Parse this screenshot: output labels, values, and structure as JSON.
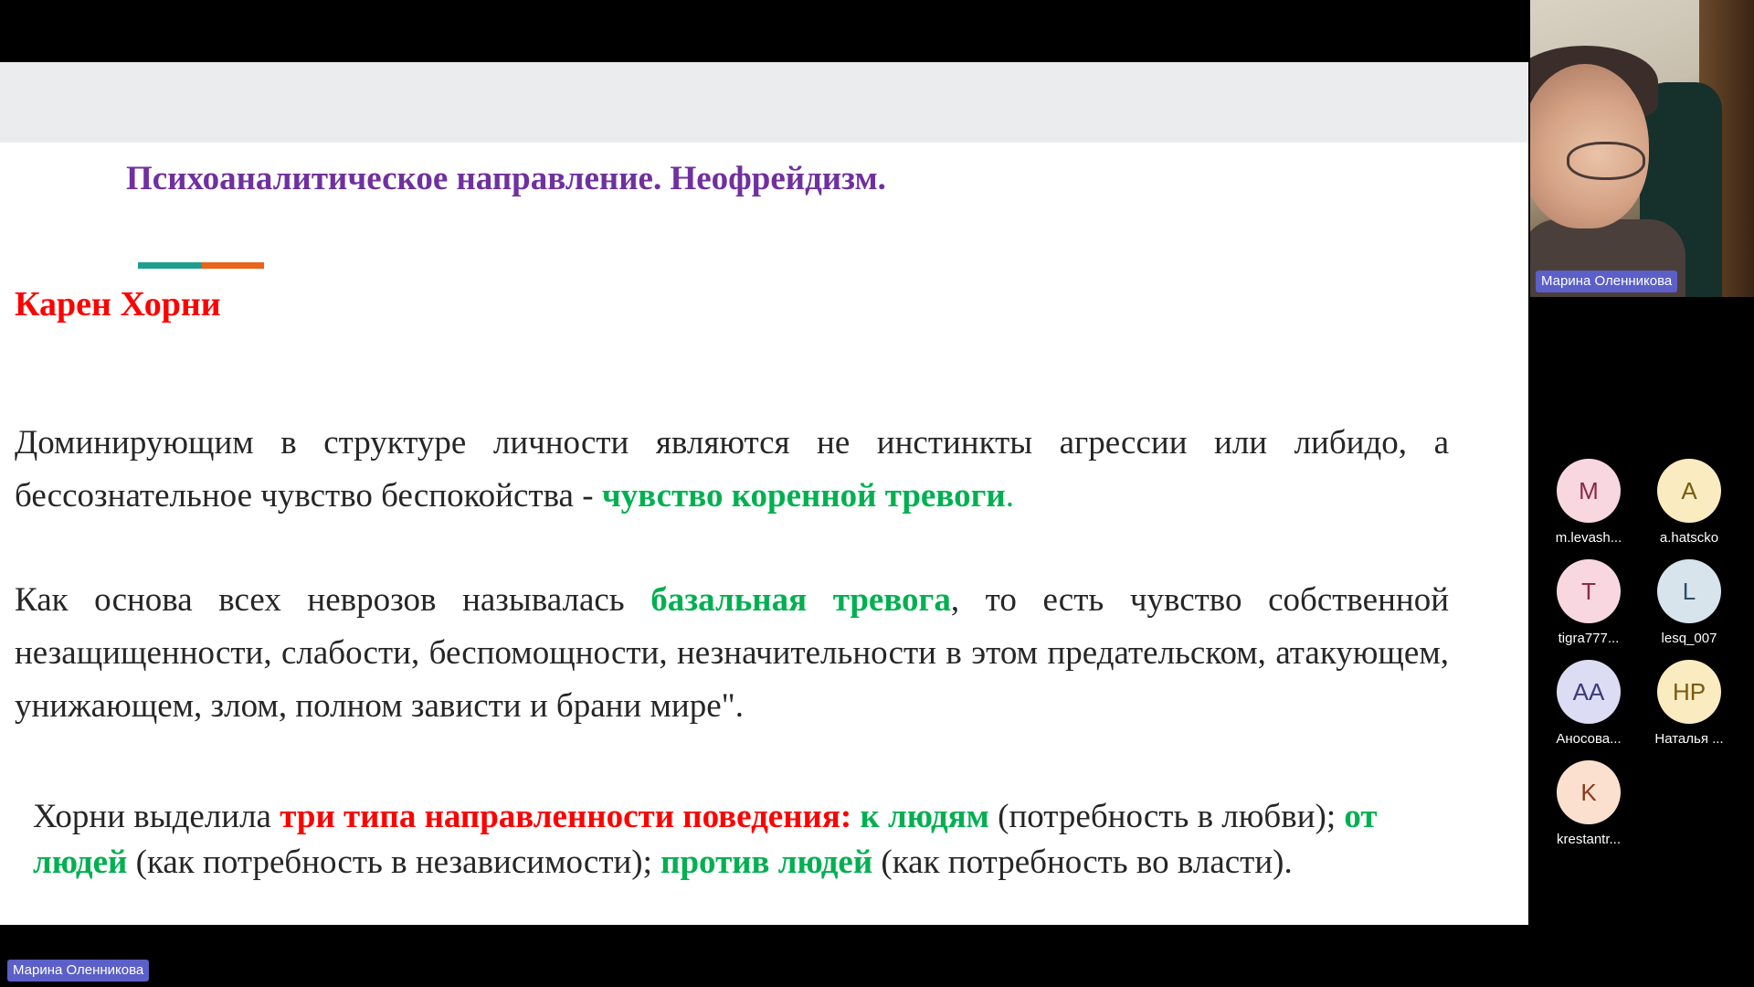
{
  "slide": {
    "title": "Психоаналитическое направление. Неофрейдизм.",
    "heading": "Карен Хорни",
    "colors": {
      "title": "#7030a0",
      "heading": "#ff0000",
      "accent1": "#1f9e8f",
      "accent2": "#e8641b"
    },
    "paragraph1": {
      "text": "Доминирующим в структуре личности являются не инстинкты агрессии или либидо, а бессознательное чувство беспокойства - ",
      "highlight": "чувство коренной тревоги",
      "end": "."
    },
    "paragraph2": {
      "start": "Как основа всех неврозов называлась ",
      "highlight": "базальная тревога",
      "rest": ", то есть чувство собственной незащищенности, слабости, беспомощности, незначительности в этом предательском, атакующем, унижающем, злом, полном зависти и брани мире\"."
    },
    "paragraph3": {
      "start": "Хорни выделила ",
      "red": "три типа направленности поведения:",
      "g1": " к людям",
      "t1": " (потребность в любви); ",
      "g2": "от людей",
      "t2": " (как потребность в независимости); ",
      "g3": "против людей",
      "t3": "  (как потребность во власти)."
    }
  },
  "speaker": {
    "name": "Марина Оленникова"
  },
  "presenter_label": "Марина Оленникова",
  "participants": [
    {
      "initials": "M",
      "label": "m.levash...",
      "bg": "#f8d7e0",
      "fg": "#8a2a45"
    },
    {
      "initials": "A",
      "label": "a.hatscko",
      "bg": "#faecc0",
      "fg": "#7a5a10"
    },
    {
      "initials": "T",
      "label": "tigra777...",
      "bg": "#f8d7e0",
      "fg": "#8a2a45"
    },
    {
      "initials": "L",
      "label": "lesq_007",
      "bg": "#d8e4ec",
      "fg": "#2c4e66"
    },
    {
      "initials": "AA",
      "label": "Аносова...",
      "bg": "#dcdcf4",
      "fg": "#3a3a7a"
    },
    {
      "initials": "НР",
      "label": "Наталья ...",
      "bg": "#faecc0",
      "fg": "#7a5a10"
    },
    {
      "initials": "K",
      "label": "krestantr...",
      "bg": "#fbe0d0",
      "fg": "#8a3a1a"
    }
  ]
}
